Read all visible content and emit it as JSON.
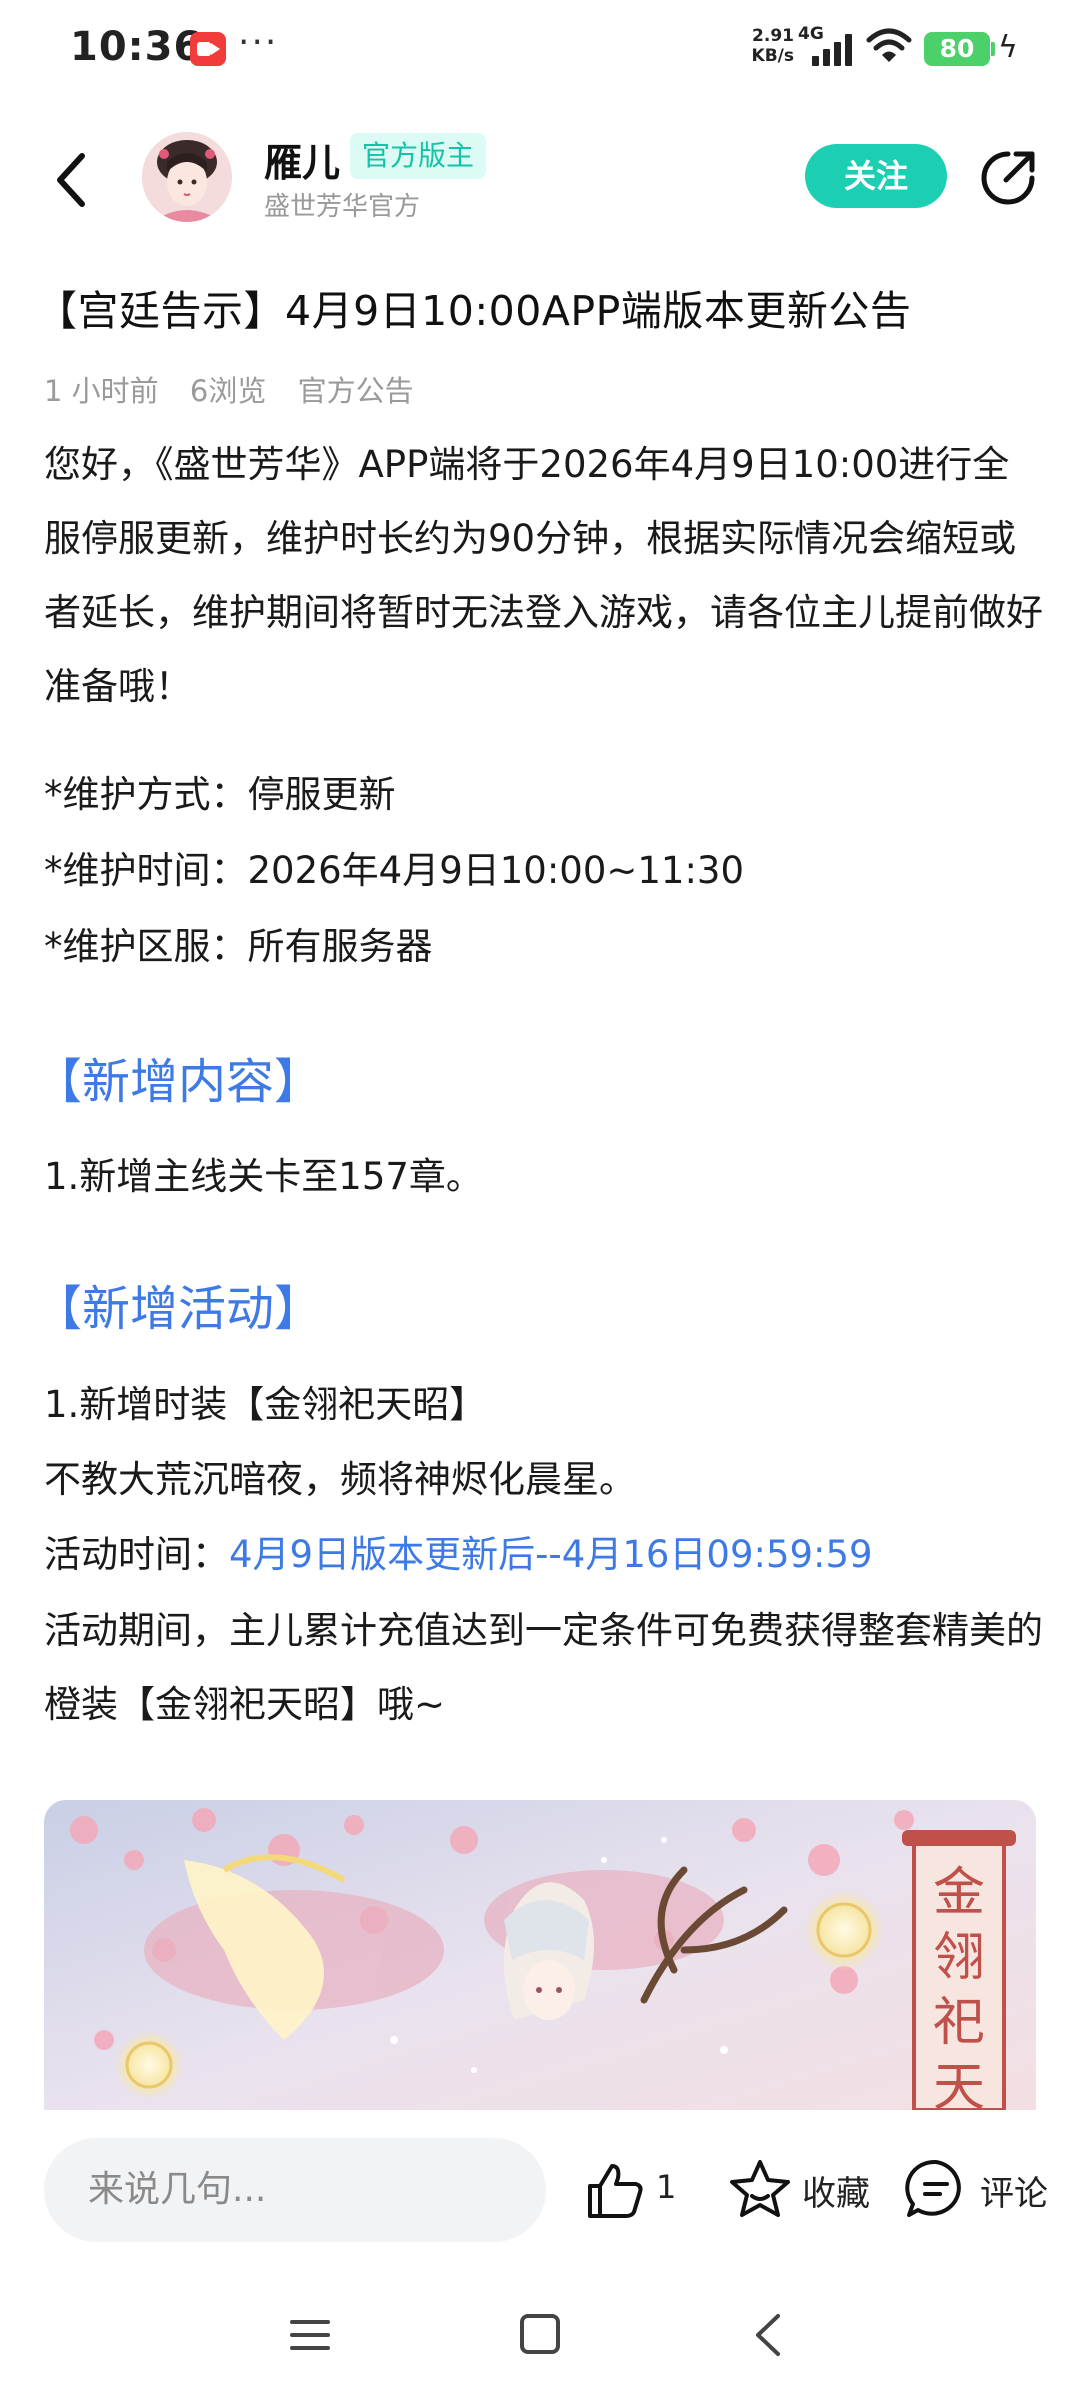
{
  "status_bar": {
    "time": "10:36",
    "more": "···",
    "net_speed_value": "2.91",
    "net_speed_unit": "KB/s",
    "network": "4G",
    "battery": "80",
    "icons": [
      "screen-record-icon",
      "signal-icon",
      "wifi-icon",
      "battery-icon",
      "charging-icon"
    ]
  },
  "header": {
    "author_name": "雁儿",
    "author_badge": "官方版主",
    "author_sub": "盛世芳华官方",
    "follow_label": "关注",
    "accent_color": "#1ccfb3"
  },
  "article": {
    "title": "【宫廷告示】4月9日10:00APP端版本更新公告",
    "meta": {
      "time_ago": "1 小时前",
      "views": "6浏览",
      "category": "官方公告"
    },
    "intro": "您好，《盛世芳华》APP端将于2026年4月9日10:00进行全服停服更新，维护时长约为90分钟，根据实际情况会缩短或者延长，维护期间将暂时无法登入游戏，请各位主儿提前做好准备哦！",
    "maintenance_method": "*维护方式：停服更新",
    "maintenance_time": "*维护时间：2026年4月9日10:00~11:30",
    "maintenance_servers": "*维护区服：所有服务器",
    "section_new_content": "【新增内容】",
    "new_content_1": "1.新增主线关卡至157章。",
    "section_new_activity": "【新增活动】",
    "activity_1_title": "1.新增时装【金翎祀天昭】",
    "activity_1_poem": "不教大荒沉暗夜，频将神烬化晨星。",
    "activity_time_label": "活动时间：",
    "activity_time_value": "4月9日版本更新后--4月16日09:59:59",
    "activity_desc": "活动期间，主儿累计充值达到一定条件可免费获得整套精美的橙装【金翎祀天昭】哦~",
    "highlight_color": "#3d7ae6",
    "banner_scroll_text": "金翎祀天昭"
  },
  "action_bar": {
    "comment_placeholder": "来说几句...",
    "like_count": "1",
    "favorite_label": "收藏",
    "comment_label": "评论"
  },
  "nav_bar": {
    "icons": [
      "menu-icon",
      "home-icon",
      "back-icon"
    ]
  }
}
